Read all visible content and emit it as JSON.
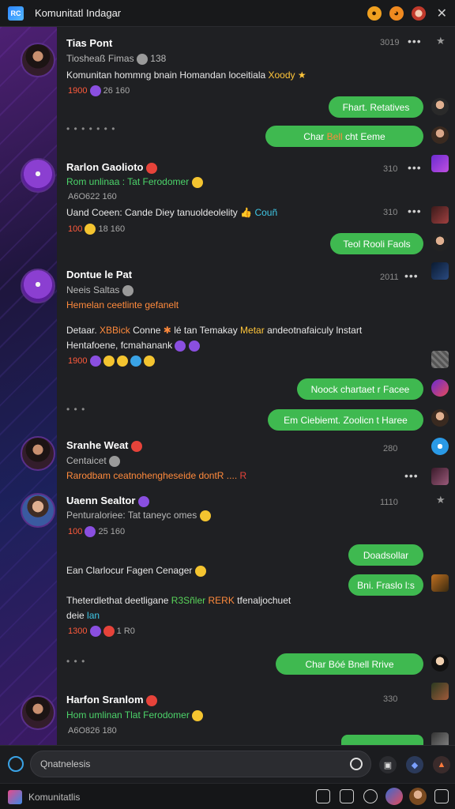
{
  "window": {
    "title": "Komunitatl Indagar",
    "logo_text": "RC",
    "icons": [
      "notification-icon",
      "emoji-icon",
      "profile-icon"
    ]
  },
  "messages": {
    "m1": {
      "name": "Tias Pont",
      "time": "3019",
      "sub": "Tiosheaß Fimas",
      "sub_count": "138",
      "text": "Komunitan hommng bnain Homandan loceitiala",
      "text_tag": "Xoody",
      "meta_num": "1900",
      "meta_b": "26",
      "meta_c": "160"
    },
    "b1": "Fhart. Retatives",
    "b2_pre": "Char",
    "b2_mid": "Bell",
    "b2_post": "cht Eeme",
    "m2": {
      "name": "Rarlon Gaolioto",
      "time": "310",
      "sub": "Rom unlinaa : Tat Ferodomer",
      "meta": "A6O622",
      "meta_b": "160",
      "text": "Uand Coeen: Cande Diey tanuoldeolelity",
      "text_tag": "Couñ",
      "time2": "310",
      "meta2_num": "100",
      "meta2_b": "18",
      "meta2_c": "160"
    },
    "b3": "Teol Rooli Faols",
    "m3": {
      "name": "Dontue le Pat",
      "time": "2011",
      "sub": "Neeis Saltas",
      "sub2": "Hemelan ceetlinte gefanelt",
      "line1_a": "Detaar.",
      "line1_b": "XBBick",
      "line1_c": "Conne",
      "line1_d": "lé tan Temakay",
      "line1_e": "Metar",
      "line1_f": "andeotnafaiculy lnstart",
      "line2": "Hentafoene, fcmahanank",
      "meta_num": "1900"
    },
    "b4": "Noock chartaet r Facee",
    "b5": "Em Ciebiemt. Zoolicn t Haree",
    "m4": {
      "name": "Sranhe Weat",
      "time": "280",
      "sub": "Centaicet",
      "sub2": "Rarodbam ceatnohengheseide dontR ....",
      "sub2_tag": "R"
    },
    "m5": {
      "name": "Uaenn Sealtor",
      "time": "1110",
      "sub": "Penturaloriee: Tat taneyc omes",
      "meta_num": "100",
      "meta_b": "25",
      "meta_c": "160"
    },
    "b6": "Doadsollar",
    "b7": "Bni. Fraslo l:s",
    "m6": {
      "line_a": "Ean Clarlocur Fagen Cenager",
      "line_b_1": "Theterdlethat deetligane",
      "line_b_2": "R3Sñler",
      "line_b_3": "RERK",
      "line_b_4": "tfenaljochuet",
      "line_c": "deie",
      "line_c_tag": "lan",
      "meta_num": "1300",
      "meta_c": "1 R0"
    },
    "b8": "Char Bóé Bnell Rrive",
    "m7": {
      "name": "Harfon Sranlom",
      "time": "330",
      "sub": "Hom umlinan Tlat Ferodomer",
      "meta": "A6O826",
      "meta_b": "180"
    }
  },
  "composer": {
    "placeholder": "Qnatnelesis"
  },
  "bottombar": {
    "title": "Komunitatlis"
  },
  "colors": {
    "bubble_green": "#3fb950",
    "accent_orange": "#ff8a3c",
    "accent_red": "#ff5a3c",
    "accent_blue": "#3aa3e6"
  }
}
